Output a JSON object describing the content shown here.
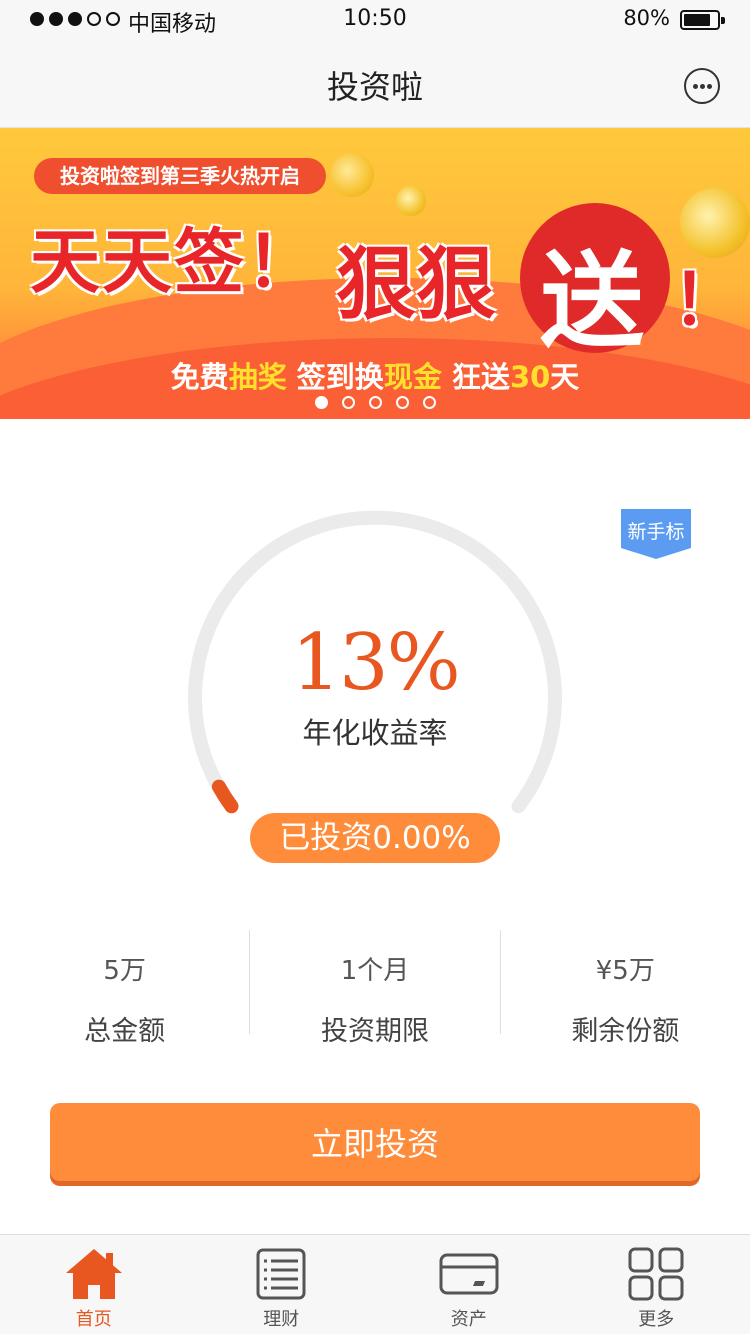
{
  "status_bar": {
    "carrier": "中国移动",
    "time": "10:50",
    "battery_percent": "80%",
    "battery_level": 0.8
  },
  "nav": {
    "title": "投资啦",
    "more_icon": "more-dots-icon"
  },
  "banner": {
    "tag": "投资啦签到第三季火热开启",
    "headline_part1": "天天签！",
    "headline_part2": "狠狠",
    "headline_part3": "送",
    "headline_part4": "！",
    "subline": {
      "part1": "免费",
      "part1_hl": "抽奖",
      "part2": "  签到换",
      "part2_hl": "现金",
      "part3": "   狂送",
      "part3_hl": "30",
      "part4": "天"
    },
    "slides": 5,
    "active_slide": 1
  },
  "product": {
    "ribbon": "新手标",
    "rate": "13%",
    "rate_label": "年化收益率",
    "invested": "已投资0.00%",
    "progress": 0.0
  },
  "stats": [
    {
      "value": "5万",
      "label": "总金额"
    },
    {
      "value": "1个月",
      "label": "投资期限"
    },
    {
      "value": "¥5万",
      "label": "剩余份额"
    }
  ],
  "invest_button": "立即投资",
  "tabs": [
    {
      "label": "首页",
      "icon": "home-icon",
      "active": true
    },
    {
      "label": "理财",
      "icon": "list-icon",
      "active": false
    },
    {
      "label": "资产",
      "icon": "card-icon",
      "active": false
    },
    {
      "label": "更多",
      "icon": "grid-icon",
      "active": false
    }
  ],
  "colors": {
    "accent": "#ff8c3a",
    "rate": "#e8571f",
    "ribbon": "#5b9cf2"
  }
}
